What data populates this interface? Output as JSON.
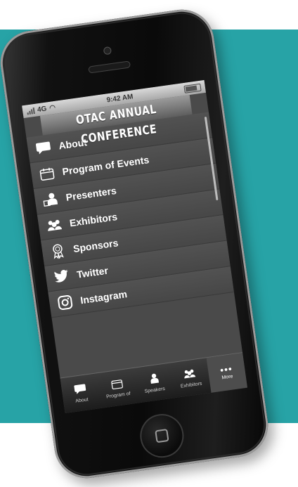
{
  "status_bar": {
    "carrier": "4G",
    "time": "9:42 AM"
  },
  "app": {
    "title": "OTAC ANNUAL CONFERENCE"
  },
  "menu": {
    "items": [
      {
        "label": "About",
        "icon": "speech-bubble-icon"
      },
      {
        "label": "Program of Events",
        "icon": "calendar-icon"
      },
      {
        "label": "Presenters",
        "icon": "presenter-icon"
      },
      {
        "label": "Exhibitors",
        "icon": "group-icon"
      },
      {
        "label": "Sponsors",
        "icon": "ribbon-icon"
      },
      {
        "label": "Twitter",
        "icon": "twitter-icon"
      },
      {
        "label": "Instagram",
        "icon": "instagram-icon"
      }
    ]
  },
  "tab_bar": {
    "tabs": [
      {
        "label": "About",
        "icon": "speech-bubble-icon"
      },
      {
        "label": "Program of",
        "icon": "calendar-icon"
      },
      {
        "label": "Speakers",
        "icon": "presenter-icon"
      },
      {
        "label": "Exhibitors",
        "icon": "group-icon"
      },
      {
        "label": "More",
        "icon": "more-dots-icon"
      }
    ]
  },
  "colors": {
    "background_accent": "#27a3a6",
    "screen_bg": "#4a4a4a",
    "text": "#ffffff"
  }
}
